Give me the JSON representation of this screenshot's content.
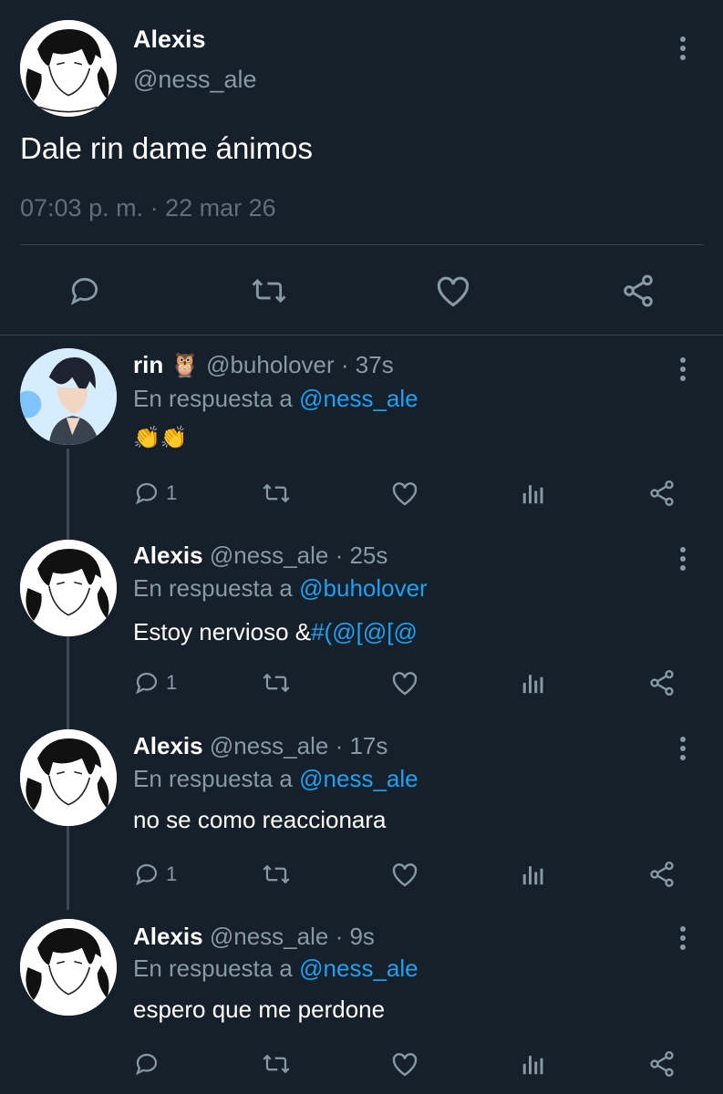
{
  "main_tweet": {
    "name": "Alexis",
    "handle": "@ness_ale",
    "text": "Dale rin dame ánimos",
    "timestamp": "07:03 p. m. · 22 mar 26",
    "actions": [
      "comment-icon",
      "retweet-icon",
      "like-icon",
      "share-icon"
    ]
  },
  "replies": [
    {
      "name": "rin",
      "emoji": "🦉",
      "handle": "@buholover",
      "time": "· 37s",
      "reply_prefix": "En respuesta a",
      "reply_to": "@ness_ale",
      "text_plain": "👏👏",
      "text_blue": "",
      "comment_count": "1"
    },
    {
      "name": "Alexis",
      "emoji": "",
      "handle": "@ness_ale",
      "time": "· 25s",
      "reply_prefix": "En respuesta a",
      "reply_to": "@buholover",
      "text_plain": "Estoy nervioso &",
      "text_blue": "#(@[@[@",
      "comment_count": "1"
    },
    {
      "name": "Alexis",
      "emoji": "",
      "handle": "@ness_ale",
      "time": "· 17s",
      "reply_prefix": "En respuesta a",
      "reply_to": "@ness_ale",
      "text_plain": "no se como reaccionara",
      "text_blue": "",
      "comment_count": "1"
    },
    {
      "name": "Alexis",
      "emoji": "",
      "handle": "@ness_ale",
      "time": "· 9s",
      "reply_prefix": "En respuesta a",
      "reply_to": "@ness_ale",
      "text_plain": "espero que me perdone",
      "text_blue": "",
      "comment_count": ""
    }
  ],
  "colors": {
    "background": "#15202b",
    "accent": "#1da1f2",
    "muted": "#8899a6",
    "divider": "#38444d"
  }
}
